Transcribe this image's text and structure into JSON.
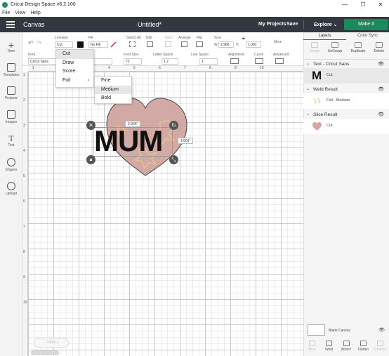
{
  "window": {
    "title": "Cricut Design Space  v6.2.100",
    "controls": [
      "—",
      "☐",
      "✕"
    ]
  },
  "menubar": [
    "File",
    "View",
    "Help"
  ],
  "header": {
    "canvas_label": "Canvas",
    "doc_title": "Untitled*",
    "my_projects": "My Projects",
    "save": "Save",
    "explore": "Explore",
    "make_it": "Make It"
  },
  "toolbar": {
    "linetype_label": "Linetype",
    "linetype_value": "Cut",
    "fill_label": "Fill",
    "fill_value": "No Fill",
    "select_all": "Select All",
    "edit": "Edit",
    "align": "Align",
    "arrange": "Arrange",
    "flip": "Flip",
    "size_label": "Size",
    "w_label": "W",
    "w_value": "2.966",
    "h_label": "H",
    "h_value": "1.001",
    "more": "More",
    "font_label": "Font",
    "font_value": "Cricut Sans",
    "font_size_label": "Font Size",
    "font_size_value": "72",
    "letter_space_label": "Letter Space",
    "letter_space_value": "1.2",
    "line_space_label": "Line Space",
    "line_space_value": "1",
    "alignment_label": "Alignment",
    "curve_label": "Curve",
    "advanced_label": "Advanced"
  },
  "linetype_menu": [
    "Cut",
    "Draw",
    "Score",
    "Foil"
  ],
  "foil_submenu": [
    "Fine",
    "Medium",
    "Bold"
  ],
  "foil_selected": "Medium",
  "leftbar": [
    {
      "label": "New",
      "icon": "plus-icon"
    },
    {
      "label": "Templates",
      "icon": "shirt-icon"
    },
    {
      "label": "Projects",
      "icon": "projects-icon"
    },
    {
      "label": "Images",
      "icon": "image-icon"
    },
    {
      "label": "Text",
      "icon": "text-icon"
    },
    {
      "label": "Shapes",
      "icon": "shapes-icon"
    },
    {
      "label": "Upload",
      "icon": "upload-icon"
    }
  ],
  "ruler_top": [
    "1",
    "2",
    "3",
    "4",
    "5",
    "6",
    "7",
    "8",
    "9",
    "10"
  ],
  "ruler_left": [
    "1",
    "2",
    "3",
    "4",
    "5",
    "6",
    "7",
    "8",
    "9",
    "10"
  ],
  "canvas": {
    "text": "MUM",
    "width_readout": "2.966\"",
    "height_readout": "1.001\"",
    "zoom": "100%",
    "heart_color": "#d3a9a5",
    "flower_color": "#e8c48c"
  },
  "rpanel": {
    "tabs": [
      "Layers",
      "Color Sync"
    ],
    "actions": [
      "Group",
      "UnGroup",
      "Duplicate",
      "Delete"
    ],
    "groups": [
      {
        "title": "Text - Cricut Sans",
        "row": "Cut",
        "thumb": "M"
      },
      {
        "title": "Weld Result",
        "row": "Foil - Medium"
      },
      {
        "title": "Slice Result",
        "row": "Cut"
      }
    ],
    "blank_canvas": "Blank Canvas",
    "bottom_actions": [
      "Slice",
      "Weld",
      "Attach",
      "Flatten",
      "Contour"
    ]
  }
}
